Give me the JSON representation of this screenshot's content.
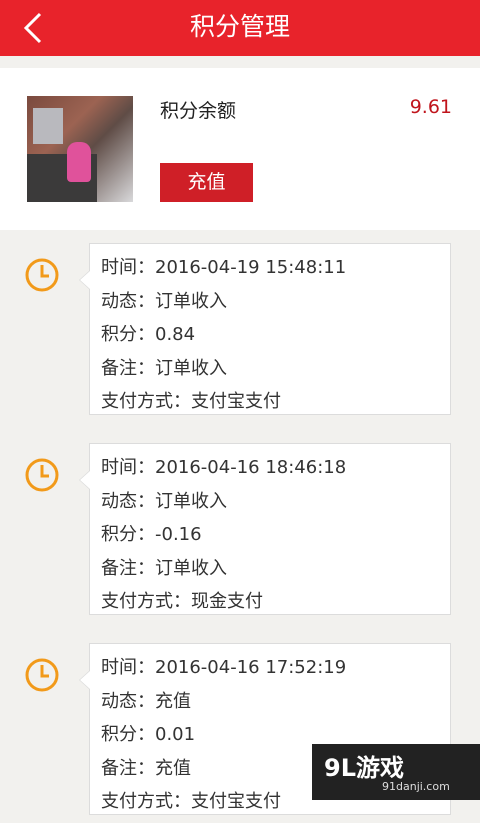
{
  "header": {
    "title": "积分管理"
  },
  "balance": {
    "label": "积分余额",
    "value": "9.61",
    "button_label": "充值"
  },
  "labels": {
    "time": "时间：",
    "status": "动态：",
    "points": "积分：",
    "note": "备注：",
    "pay": "支付方式："
  },
  "records": [
    {
      "time": "2016-04-19 15:48:11",
      "status": "订单收入",
      "points": "0.84",
      "note": "订单收入",
      "pay": "支付宝支付"
    },
    {
      "time": "2016-04-16 18:46:18",
      "status": "订单收入",
      "points": "-0.16",
      "note": "订单收入",
      "pay": "现金支付"
    },
    {
      "time": "2016-04-16 17:52:19",
      "status": "充值",
      "points": "0.01",
      "note": "充值",
      "pay": "支付宝支付"
    }
  ],
  "watermark": {
    "main": "9L游戏",
    "sub": "91danji.com"
  },
  "colors": {
    "primary": "#e8232b",
    "accent_orange": "#f29a1a"
  }
}
